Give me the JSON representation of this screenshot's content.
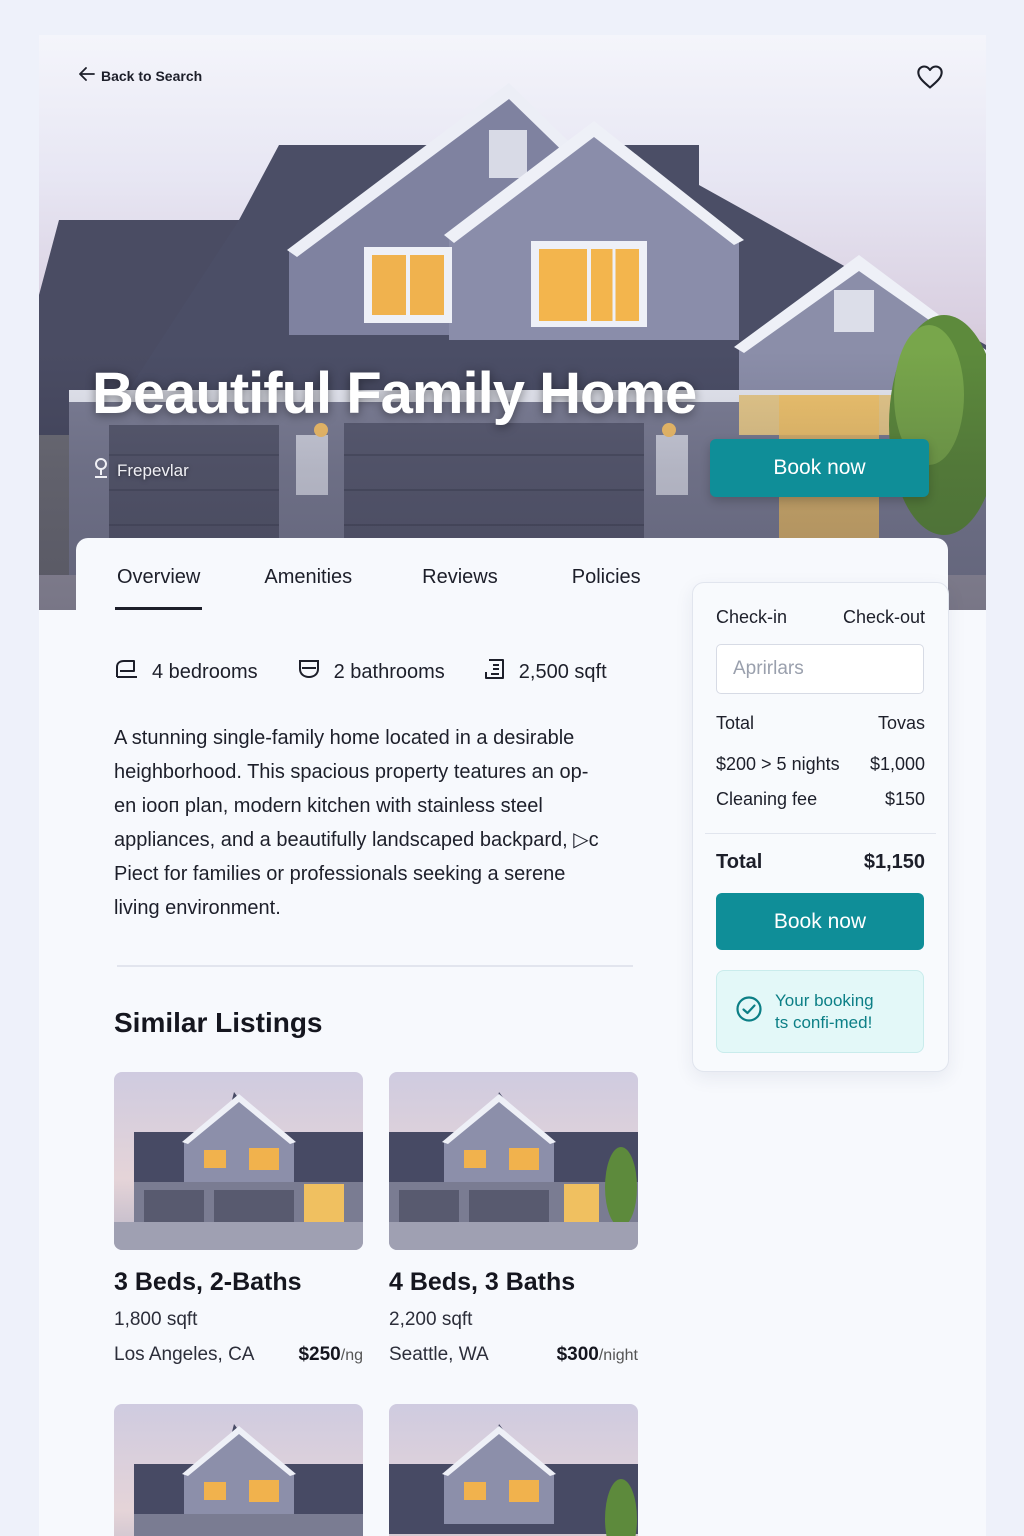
{
  "header": {
    "back_label": "Back to Search"
  },
  "hero": {
    "title": "Beautiful Family Home",
    "location": "Frepevlar",
    "book_label": "Book now"
  },
  "tabs": [
    {
      "label": "Overview"
    },
    {
      "label": "Amenities"
    },
    {
      "label": "Reviews"
    },
    {
      "label": "Policies"
    }
  ],
  "stats": {
    "bedrooms": "4 bedrooms",
    "bathrooms": "2 bathrooms",
    "area": "2,500 sqft"
  },
  "description": {
    "lines": [
      "A stunning single-family home located in a desirable",
      "heighborhood. This spacious property teatures an op-",
      "en iooп plan, modern kitchen with stainless steel",
      "appliances, and a beautifully landscaped backpard, ▷c",
      "Piect for families or professionals seeking a serene",
      "living environment."
    ]
  },
  "similar": {
    "title": "Similar Listings",
    "listings": [
      {
        "title": "3 Beds, 2-Baths",
        "sqft": "1,800 sqft",
        "location": "Los Angeles, CA",
        "price": "$250",
        "unit": "/ng"
      },
      {
        "title": "4 Beds, 3 Baths",
        "sqft": "2,200 sqft",
        "location": "Seattle, WA",
        "price": "$300",
        "unit": "/night"
      }
    ]
  },
  "booking": {
    "checkin_label": "Check-in",
    "checkout_label": "Check-out",
    "date_placeholder": "Aprirlars",
    "total_label": "Total",
    "total_right": "Tovas",
    "nights_label": "$200 > 5 nights",
    "nights_value": "$1,000",
    "cleaning_label": "Cleaning fee",
    "cleaning_value": "$150",
    "grand_total_label": "Total",
    "grand_total_value": "$1,150",
    "book_label": "Book now",
    "confirm_line1": "Your booking",
    "confirm_line2": "ts confi-med!"
  },
  "colors": {
    "accent": "#0f8e98",
    "confirm_bg": "#e3f8f8",
    "background": "#eef1fa"
  }
}
